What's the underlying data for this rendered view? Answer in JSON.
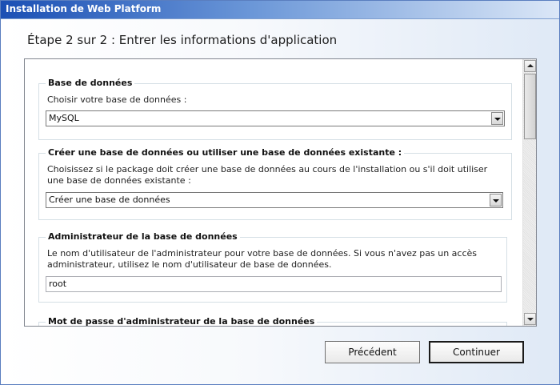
{
  "window": {
    "title": "Installation de Web Platform"
  },
  "step": {
    "heading": "Étape 2 sur 2 : Entrer les informations d'application"
  },
  "sections": {
    "database": {
      "title": "Base de données",
      "description": "Choisir votre base de données :",
      "selected": "MySQL"
    },
    "create_or_use": {
      "title": "Créer une base de données ou utiliser une base de données existante :",
      "description": "Choisissez si le package doit créer une base de données au cours de l'installation ou s'il doit utiliser une base de données existante :",
      "selected": "Créer une base de données"
    },
    "admin": {
      "title": "Administrateur de la base de données",
      "description": "Le nom d'utilisateur de l'administrateur pour votre base de données. Si vous n'avez pas un accès administrateur, utilisez le nom d'utilisateur de base de données.",
      "value": "root"
    },
    "admin_password": {
      "title": "Mot de passe d'administrateur de la base de données"
    }
  },
  "buttons": {
    "previous": "Précédent",
    "continue": "Continuer"
  },
  "icons": {
    "dropdown": "chevron-down-icon",
    "scroll_up": "arrow-up-icon",
    "scroll_down": "arrow-down-icon"
  },
  "colors": {
    "titlebar_start": "#1b4fb4",
    "border": "#828790"
  }
}
